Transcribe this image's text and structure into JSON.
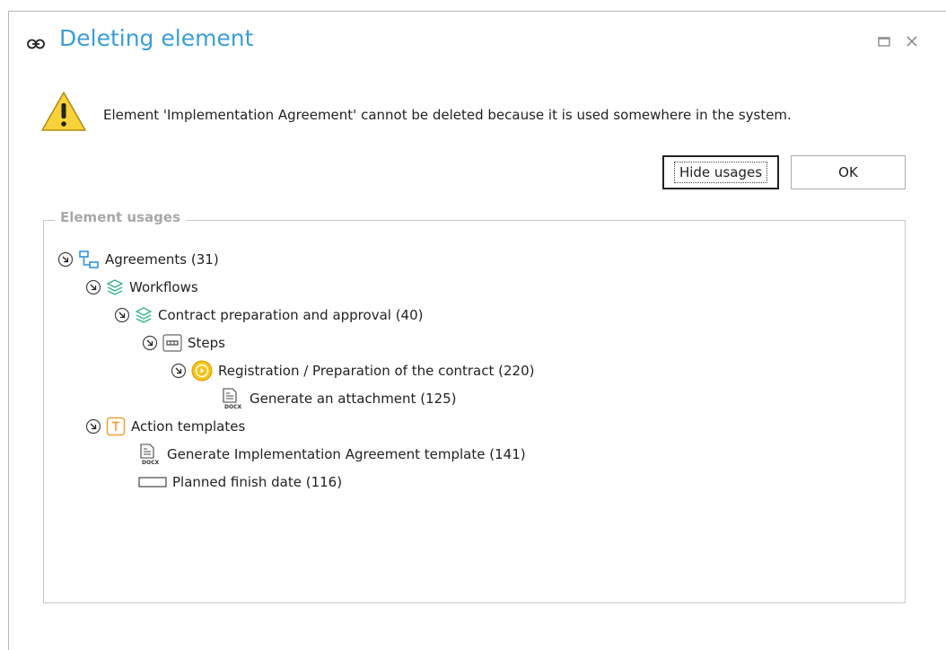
{
  "dialog": {
    "title": "Deleting element",
    "title_icon": "link-icon",
    "accent_color": "#3a9ed8"
  },
  "message": "Element 'Implementation Agreement' cannot be deleted because it is used somewhere in the system.",
  "buttons": {
    "hide_usages": "Hide usages",
    "ok": "OK"
  },
  "usages": {
    "legend": "Element usages",
    "items": [
      {
        "label": "Agreements (31)",
        "icon": "process-icon"
      },
      {
        "label": "Workflows",
        "icon": "layers-icon"
      },
      {
        "label": "Contract preparation and approval (40)",
        "icon": "layers-icon"
      },
      {
        "label": "Steps",
        "icon": "steps-icon"
      },
      {
        "label": "Registration / Preparation of the contract (220)",
        "icon": "play-step-icon"
      },
      {
        "label": "Generate an attachment (125)",
        "icon": "docx-template-icon"
      },
      {
        "label": "Action templates",
        "icon": "template-t-icon"
      },
      {
        "label": "Generate Implementation Agreement template (141)",
        "icon": "docx-template-icon"
      },
      {
        "label": "Planned finish date (116)",
        "icon": "field-icon"
      }
    ]
  }
}
